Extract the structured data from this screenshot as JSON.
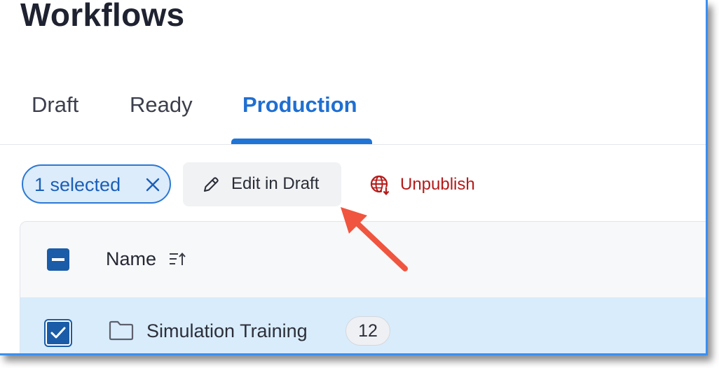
{
  "page": {
    "title": "Workflows"
  },
  "tabs": [
    {
      "label": "Draft",
      "active": false
    },
    {
      "label": "Ready",
      "active": false
    },
    {
      "label": "Production",
      "active": true
    }
  ],
  "toolbar": {
    "selection_label": "1 selected",
    "clear_icon": "close-icon",
    "edit_label": "Edit in Draft",
    "edit_icon": "pencil-icon",
    "unpublish_label": "Unpublish",
    "unpublish_icon": "globe-download-icon"
  },
  "table": {
    "columns": [
      {
        "label": "Name",
        "sort_icon": "sort-ascending-icon"
      }
    ],
    "header_checkbox_state": "indeterminate",
    "rows": [
      {
        "name": "Simulation Training",
        "count": "12",
        "checked": true,
        "icon": "folder-icon"
      }
    ]
  },
  "colors": {
    "accent": "#1f74d6",
    "danger": "#b51a1a",
    "selection_bg": "#dcecfb",
    "row_selected_bg": "#d9ecfb",
    "annotation_arrow": "#f0553f"
  }
}
